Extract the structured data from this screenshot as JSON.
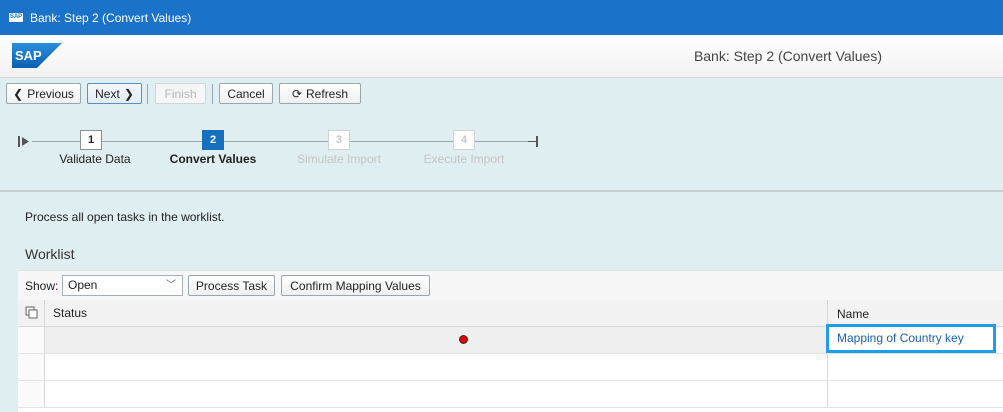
{
  "window": {
    "title": "Bank: Step 2  (Convert Values)",
    "logo_text": "SAP"
  },
  "shell": {
    "title": "Bank: Step 2  (Convert Values)",
    "logo_text": "SAP"
  },
  "toolbar": {
    "previous": "Previous",
    "next": "Next",
    "finish": "Finish",
    "cancel": "Cancel",
    "refresh": "Refresh"
  },
  "steps": [
    {
      "number": "1",
      "label": "Validate Data",
      "state": "done"
    },
    {
      "number": "2",
      "label": "Convert Values",
      "state": "active"
    },
    {
      "number": "3",
      "label": "Simulate Import",
      "state": "inactive"
    },
    {
      "number": "4",
      "label": "Execute Import",
      "state": "inactive"
    }
  ],
  "instruction": "Process all open tasks in the worklist.",
  "worklist": {
    "title": "Worklist",
    "show_label": "Show:",
    "show_value": "Open",
    "process_task": "Process Task",
    "confirm_mapping": "Confirm Mapping Values",
    "columns": {
      "status": "Status",
      "name": "Name"
    },
    "rows": [
      {
        "status": "error",
        "status_color": "#e00000",
        "name": "Mapping of Country key"
      }
    ]
  }
}
